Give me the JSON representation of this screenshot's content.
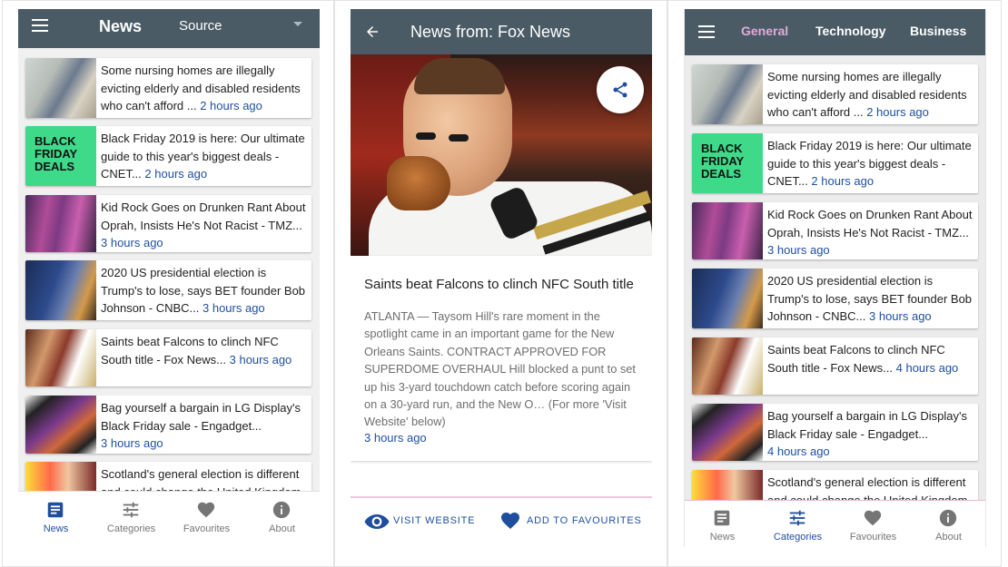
{
  "feed": {
    "app_title": "News",
    "source_label": "Source",
    "items": [
      {
        "title": "Some nursing homes are illegally evicting elderly and disabled residents who can't afford ...",
        "time": "2 hours ago"
      },
      {
        "title": "Black Friday 2019 is here: Our ultimate guide to this year's biggest deals - CNET...",
        "time": "2 hours ago"
      },
      {
        "title": "Kid Rock Goes on Drunken Rant About Oprah, Insists He's Not Racist - TMZ...",
        "time": "3 hours ago"
      },
      {
        "title": "2020 US presidential election is Trump's to lose, says BET founder Bob Johnson - CNBC...",
        "time": "3 hours ago"
      },
      {
        "title": "Saints beat Falcons to clinch NFC South title - Fox News...",
        "time": "3 hours ago"
      },
      {
        "title": "Bag yourself a bargain in LG Display's Black Friday sale - Engadget...",
        "time": "3 hours ago"
      },
      {
        "title": "Scotland's general election is different and could change the United Kingdom",
        "time": ""
      }
    ],
    "thumb_text": {
      "black_friday": "BLACK\nFRIDAY\nDEALS"
    }
  },
  "feed3": {
    "items": [
      {
        "title": "Some nursing homes are illegally evicting elderly and disabled residents who can't afford ...",
        "time": "2 hours ago"
      },
      {
        "title": "Black Friday 2019 is here: Our ultimate guide to this year's biggest deals - CNET...",
        "time": "2 hours ago"
      },
      {
        "title": "Kid Rock Goes on Drunken Rant About Oprah, Insists He's Not Racist - TMZ...",
        "time": "3 hours ago"
      },
      {
        "title": "2020 US presidential election is Trump's to lose, says BET founder Bob Johnson - CNBC...",
        "time": "3 hours ago"
      },
      {
        "title": "Saints beat Falcons to clinch NFC South title - Fox News...",
        "time": "4 hours ago"
      },
      {
        "title": "Bag yourself a bargain in LG Display's Black Friday sale - Engadget...",
        "time": "4 hours ago"
      },
      {
        "title": "Scotland's general election is different and could change the United Kingdom",
        "time": ""
      }
    ]
  },
  "nav": {
    "items": [
      {
        "label": "News",
        "icon": "article-icon"
      },
      {
        "label": "Categories",
        "icon": "tune-icon"
      },
      {
        "label": "Favourites",
        "icon": "heart-icon"
      },
      {
        "label": "About",
        "icon": "info-icon"
      }
    ],
    "active_color": "#1f4e9f",
    "inactive_color": "#757575"
  },
  "detail": {
    "title": "News from: Fox News",
    "article_title": "Saints beat Falcons to clinch NFC South title",
    "article_body": "ATLANTA — Taysom Hill's rare moment in the spotlight came in an important game for the New Orleans Saints. CONTRACT APPROVED FOR SUPERDOME OVERHAUL Hill blocked a punt to set up his 3-yard touchdown catch before scoring again on a 30-yard run, and the New O… (For more 'Visit Website' below)",
    "time": "3 hours ago",
    "visit_label": "VISIT WEBSITE",
    "favourite_label": "ADD TO FAVOURITES"
  },
  "tabs": {
    "items": [
      "General",
      "Technology",
      "Business"
    ],
    "active_index": 0,
    "active_color": "#e4a9d8"
  },
  "colors": {
    "appbar": "#4a5b66",
    "link": "#1f4e9f"
  }
}
